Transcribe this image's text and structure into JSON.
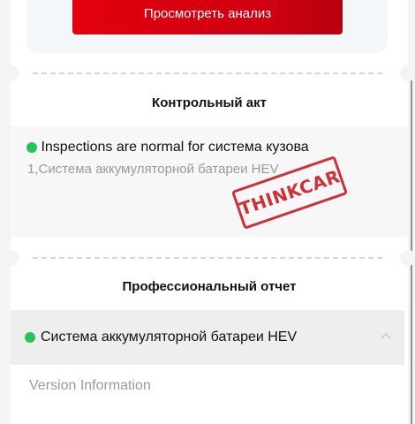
{
  "top": {
    "button_label": "Просмотреть анализ"
  },
  "control_act": {
    "title": "Контрольный акт",
    "status_line": "Inspections are normal for  система кузова",
    "item_line": "1,Система аккумуляторной батареи HEV",
    "stamp_text": "THINKCAR",
    "status_color": "#27c25a"
  },
  "pro_report": {
    "title": "Профессиональный отчет",
    "accordion_label": "Система аккумуляторной батареи HEV",
    "version_label": "Version Information"
  },
  "colors": {
    "accent": "#e3000f",
    "stamp": "#c8232c"
  },
  "icons": {
    "status": "status-dot-icon",
    "collapse": "chevron-up-icon"
  }
}
